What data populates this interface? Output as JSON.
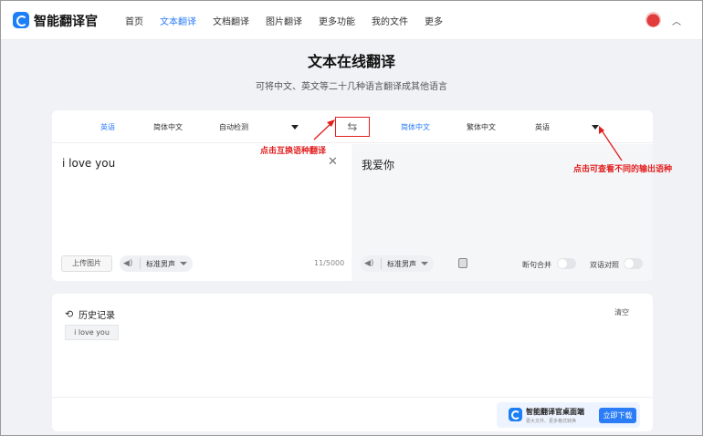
{
  "header": {
    "app_name": "智能翻译官",
    "nav": [
      "首页",
      "文本翻译",
      "文档翻译",
      "图片翻译",
      "更多功能",
      "我的文件",
      "更多"
    ],
    "active_nav_index": 1
  },
  "hero": {
    "title": "文本在线翻译",
    "subtitle": "可将中文、英文等二十几种语言翻译成其他语言"
  },
  "source_langs": [
    "英语",
    "简体中文",
    "自动检测"
  ],
  "target_langs": [
    "简体中文",
    "繁体中文",
    "英语"
  ],
  "source": {
    "text": "i love you",
    "upload_label": "上传图片",
    "voice_label": "标准男声",
    "char_count": "11/5000"
  },
  "target": {
    "text": "我爱你",
    "voice_label": "标准男声",
    "toggle_merge_label": "断句合并",
    "toggle_compare_label": "双语对照"
  },
  "annotations": {
    "swap_note": "点击互换语种翻译",
    "output_note": "点击可查看不同的输出语种"
  },
  "history": {
    "title": "历史记录",
    "clear_label": "清空",
    "items": [
      "i love you"
    ]
  },
  "promo": {
    "title": "智能翻译官桌面端",
    "subtitle": "更大文件、更多格式转换",
    "button_label": "立即下载"
  },
  "colors": {
    "accent": "#2a7cf7",
    "annotation": "#e21d1d"
  }
}
